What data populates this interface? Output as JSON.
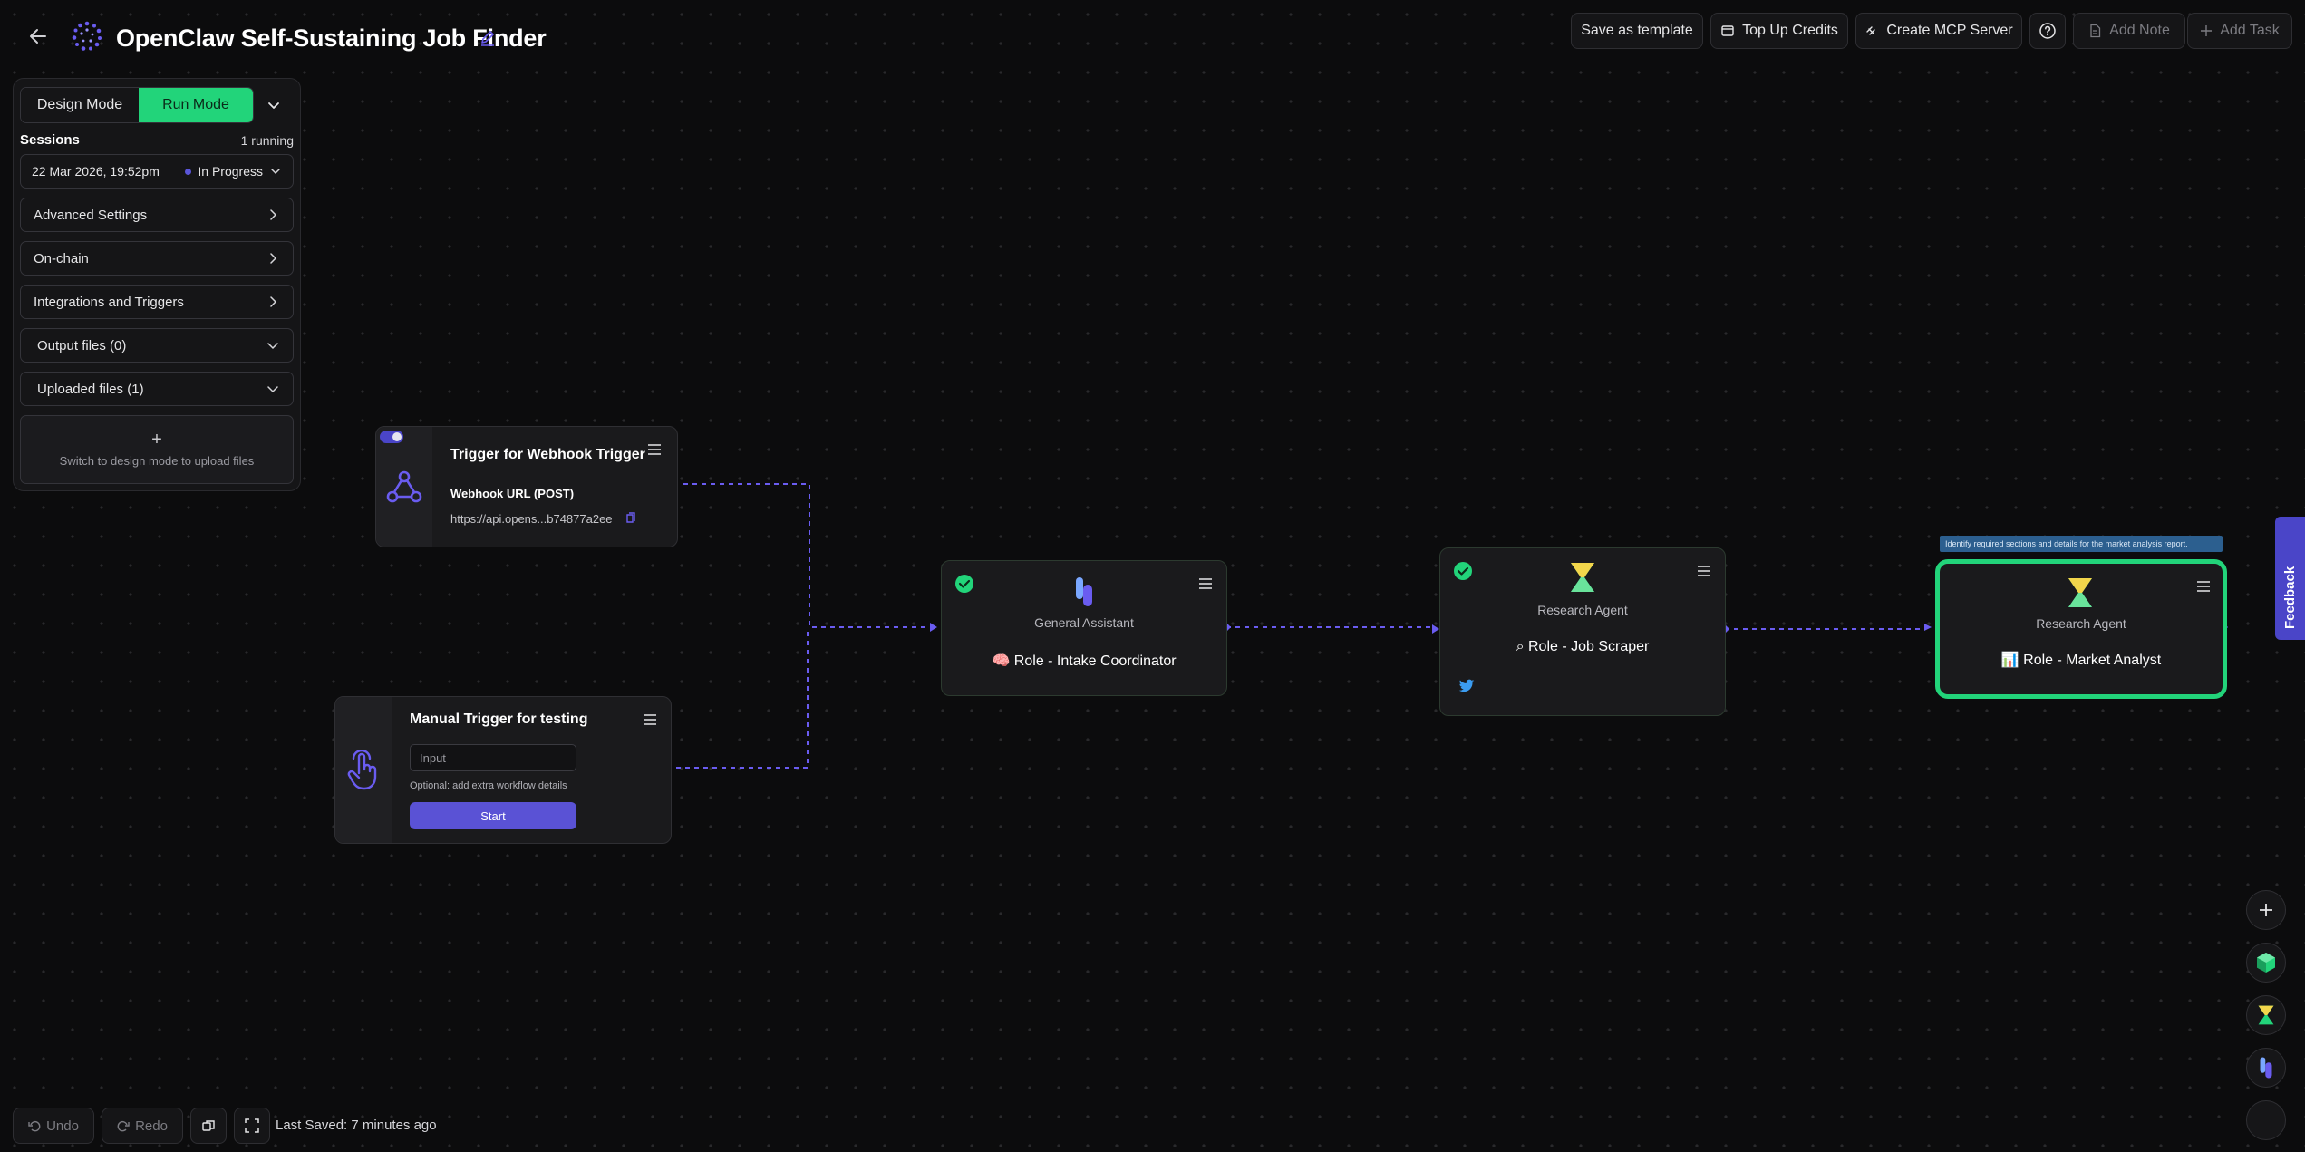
{
  "header": {
    "back_icon": "arrow-left-icon",
    "logo_icon": "dotted-spinner-logo",
    "title": "OpenClaw Self-Sustaining Job Finder",
    "edit_icon": "pencil-icon"
  },
  "toolbar": {
    "save_template": "Save as template",
    "top_up": "Top Up Credits",
    "create_mcp": "Create MCP Server",
    "help_icon": "help-circle-icon",
    "add_note": "Add Note",
    "add_task": "Add Task"
  },
  "left_panel": {
    "design_mode": "Design Mode",
    "run_mode": "Run Mode",
    "sessions_label": "Sessions",
    "sessions_count": "1 running",
    "session_date": "22 Mar 2026, 19:52pm",
    "session_status": "In Progress",
    "sections": [
      {
        "label": "Advanced Settings"
      },
      {
        "label": "On-chain"
      },
      {
        "label": "Integrations and Triggers"
      },
      {
        "label": "Output files (0)"
      },
      {
        "label": "Uploaded files (1)"
      }
    ],
    "upload_hint": "Switch to design mode to upload files"
  },
  "nodes": {
    "webhook": {
      "title": "Trigger for Webhook Trigger",
      "url_label": "Webhook URL (POST)",
      "url_value": "https://api.opens...b74877a2ee"
    },
    "manual": {
      "title": "Manual Trigger for testing",
      "input_placeholder": "Input",
      "hint": "Optional: add extra workflow details",
      "start_label": "Start"
    },
    "intake": {
      "type": "General Assistant",
      "role": "🧠 Role - Intake Coordinator"
    },
    "scraper": {
      "type": "Research Agent",
      "role": "⌕ Role - Job Scraper"
    },
    "analyst": {
      "type": "Research Agent",
      "role": "📊 Role - Market Analyst",
      "note": "Identify required sections and details for the market analysis report."
    }
  },
  "feedback_label": "Feedback",
  "bottom_bar": {
    "undo": "Undo",
    "redo": "Redo",
    "last_saved": "Last Saved: 7 minutes ago"
  },
  "colors": {
    "accent_green": "#22d47a",
    "accent_purple": "#5a52d5",
    "edge_color": "#6a5cf0"
  }
}
